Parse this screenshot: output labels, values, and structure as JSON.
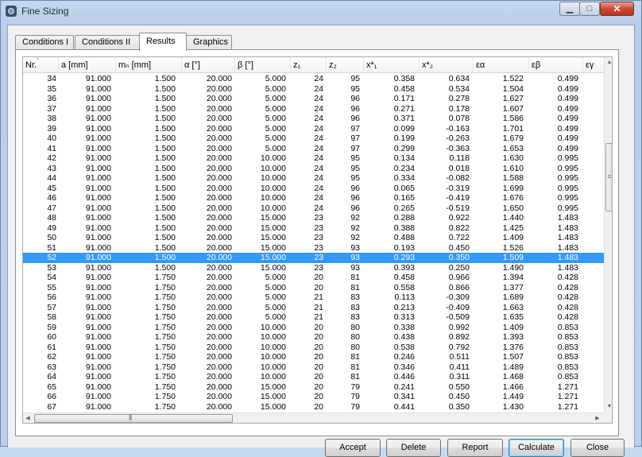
{
  "window": {
    "title": "Fine Sizing",
    "min_label": "▁",
    "max_label": "□",
    "close_label": "✕"
  },
  "tabs": [
    {
      "label": "Conditions I"
    },
    {
      "label": "Conditions II"
    },
    {
      "label": "Results"
    },
    {
      "label": "Graphics"
    }
  ],
  "table": {
    "headers": [
      "Nr.",
      "a [mm]",
      "mₙ [mm]",
      "α [°]",
      "β [°]",
      "z₁",
      "z₂",
      "x*₁",
      "x*₂",
      "εα",
      "εβ",
      "εγ"
    ],
    "sort_indicator": "^",
    "selected_row_index": 18,
    "rows": [
      [
        "34",
        "91.000",
        "1.500",
        "20.000",
        "5.000",
        "24",
        "95",
        "0.358",
        "0.634",
        "1.522",
        "0.499"
      ],
      [
        "35",
        "91.000",
        "1.500",
        "20.000",
        "5.000",
        "24",
        "95",
        "0.458",
        "0.534",
        "1.504",
        "0.499"
      ],
      [
        "36",
        "91.000",
        "1.500",
        "20.000",
        "5.000",
        "24",
        "96",
        "0.171",
        "0.278",
        "1.627",
        "0.499"
      ],
      [
        "37",
        "91.000",
        "1.500",
        "20.000",
        "5.000",
        "24",
        "96",
        "0.271",
        "0.178",
        "1.607",
        "0.499"
      ],
      [
        "38",
        "91.000",
        "1.500",
        "20.000",
        "5.000",
        "24",
        "96",
        "0.371",
        "0.078",
        "1.586",
        "0.499"
      ],
      [
        "39",
        "91.000",
        "1.500",
        "20.000",
        "5.000",
        "24",
        "97",
        "0.099",
        "-0.163",
        "1.701",
        "0.499"
      ],
      [
        "40",
        "91.000",
        "1.500",
        "20.000",
        "5.000",
        "24",
        "97",
        "0.199",
        "-0.263",
        "1.679",
        "0.499"
      ],
      [
        "41",
        "91.000",
        "1.500",
        "20.000",
        "5.000",
        "24",
        "97",
        "0.299",
        "-0.363",
        "1.653",
        "0.499"
      ],
      [
        "42",
        "91.000",
        "1.500",
        "20.000",
        "10.000",
        "24",
        "95",
        "0.134",
        "0.118",
        "1.630",
        "0.995"
      ],
      [
        "43",
        "91.000",
        "1.500",
        "20.000",
        "10.000",
        "24",
        "95",
        "0.234",
        "0.018",
        "1.610",
        "0.995"
      ],
      [
        "44",
        "91.000",
        "1.500",
        "20.000",
        "10.000",
        "24",
        "95",
        "0.334",
        "-0.082",
        "1.588",
        "0.995"
      ],
      [
        "45",
        "91.000",
        "1.500",
        "20.000",
        "10.000",
        "24",
        "96",
        "0.065",
        "-0.319",
        "1.699",
        "0.995"
      ],
      [
        "46",
        "91.000",
        "1.500",
        "20.000",
        "10.000",
        "24",
        "96",
        "0.165",
        "-0.419",
        "1.676",
        "0.995"
      ],
      [
        "47",
        "91.000",
        "1.500",
        "20.000",
        "10.000",
        "24",
        "96",
        "0.265",
        "-0.519",
        "1.650",
        "0.995"
      ],
      [
        "48",
        "91.000",
        "1.500",
        "20.000",
        "15.000",
        "23",
        "92",
        "0.288",
        "0.922",
        "1.440",
        "1.483"
      ],
      [
        "49",
        "91.000",
        "1.500",
        "20.000",
        "15.000",
        "23",
        "92",
        "0.388",
        "0.822",
        "1.425",
        "1.483"
      ],
      [
        "50",
        "91.000",
        "1.500",
        "20.000",
        "15.000",
        "23",
        "92",
        "0.488",
        "0.722",
        "1.409",
        "1.483"
      ],
      [
        "51",
        "91.000",
        "1.500",
        "20.000",
        "15.000",
        "23",
        "93",
        "0.193",
        "0.450",
        "1.526",
        "1.483"
      ],
      [
        "52",
        "91.000",
        "1.500",
        "20.000",
        "15.000",
        "23",
        "93",
        "0.293",
        "0.350",
        "1.509",
        "1.483"
      ],
      [
        "53",
        "91.000",
        "1.500",
        "20.000",
        "15.000",
        "23",
        "93",
        "0.393",
        "0.250",
        "1.490",
        "1.483"
      ],
      [
        "54",
        "91.000",
        "1.750",
        "20.000",
        "5.000",
        "20",
        "81",
        "0.458",
        "0.966",
        "1.394",
        "0.428"
      ],
      [
        "55",
        "91.000",
        "1.750",
        "20.000",
        "5.000",
        "20",
        "81",
        "0.558",
        "0.866",
        "1.377",
        "0.428"
      ],
      [
        "56",
        "91.000",
        "1.750",
        "20.000",
        "5.000",
        "21",
        "83",
        "0.113",
        "-0.309",
        "1.689",
        "0.428"
      ],
      [
        "57",
        "91.000",
        "1.750",
        "20.000",
        "5.000",
        "21",
        "83",
        "0.213",
        "-0.409",
        "1.663",
        "0.428"
      ],
      [
        "58",
        "91.000",
        "1.750",
        "20.000",
        "5.000",
        "21",
        "83",
        "0.313",
        "-0.509",
        "1.635",
        "0.428"
      ],
      [
        "59",
        "91.000",
        "1.750",
        "20.000",
        "10.000",
        "20",
        "80",
        "0.338",
        "0.992",
        "1.409",
        "0.853"
      ],
      [
        "60",
        "91.000",
        "1.750",
        "20.000",
        "10.000",
        "20",
        "80",
        "0.438",
        "0.892",
        "1.393",
        "0.853"
      ],
      [
        "61",
        "91.000",
        "1.750",
        "20.000",
        "10.000",
        "20",
        "80",
        "0.538",
        "0.792",
        "1.376",
        "0.853"
      ],
      [
        "62",
        "91.000",
        "1.750",
        "20.000",
        "10.000",
        "20",
        "81",
        "0.246",
        "0.511",
        "1.507",
        "0.853"
      ],
      [
        "63",
        "91.000",
        "1.750",
        "20.000",
        "10.000",
        "20",
        "81",
        "0.346",
        "0.411",
        "1.489",
        "0.853"
      ],
      [
        "64",
        "91.000",
        "1.750",
        "20.000",
        "10.000",
        "20",
        "81",
        "0.446",
        "0.311",
        "1.468",
        "0.853"
      ],
      [
        "65",
        "91.000",
        "1.750",
        "20.000",
        "15.000",
        "20",
        "79",
        "0.241",
        "0.550",
        "1.466",
        "1.271"
      ],
      [
        "66",
        "91.000",
        "1.750",
        "20.000",
        "15.000",
        "20",
        "79",
        "0.341",
        "0.450",
        "1.449",
        "1.271"
      ],
      [
        "67",
        "91.000",
        "1.750",
        "20.000",
        "15.000",
        "20",
        "79",
        "0.441",
        "0.350",
        "1.430",
        "1.271"
      ]
    ]
  },
  "scrollbars": {
    "up": "▲",
    "down": "▼",
    "left": "◀",
    "right": "▶"
  },
  "buttons": {
    "accept": "Accept",
    "delete": "Delete",
    "report": "Report",
    "calculate": "Calculate",
    "close": "Close"
  },
  "colors": {
    "selection": "#3399ff",
    "title_close": "#c94a33"
  }
}
